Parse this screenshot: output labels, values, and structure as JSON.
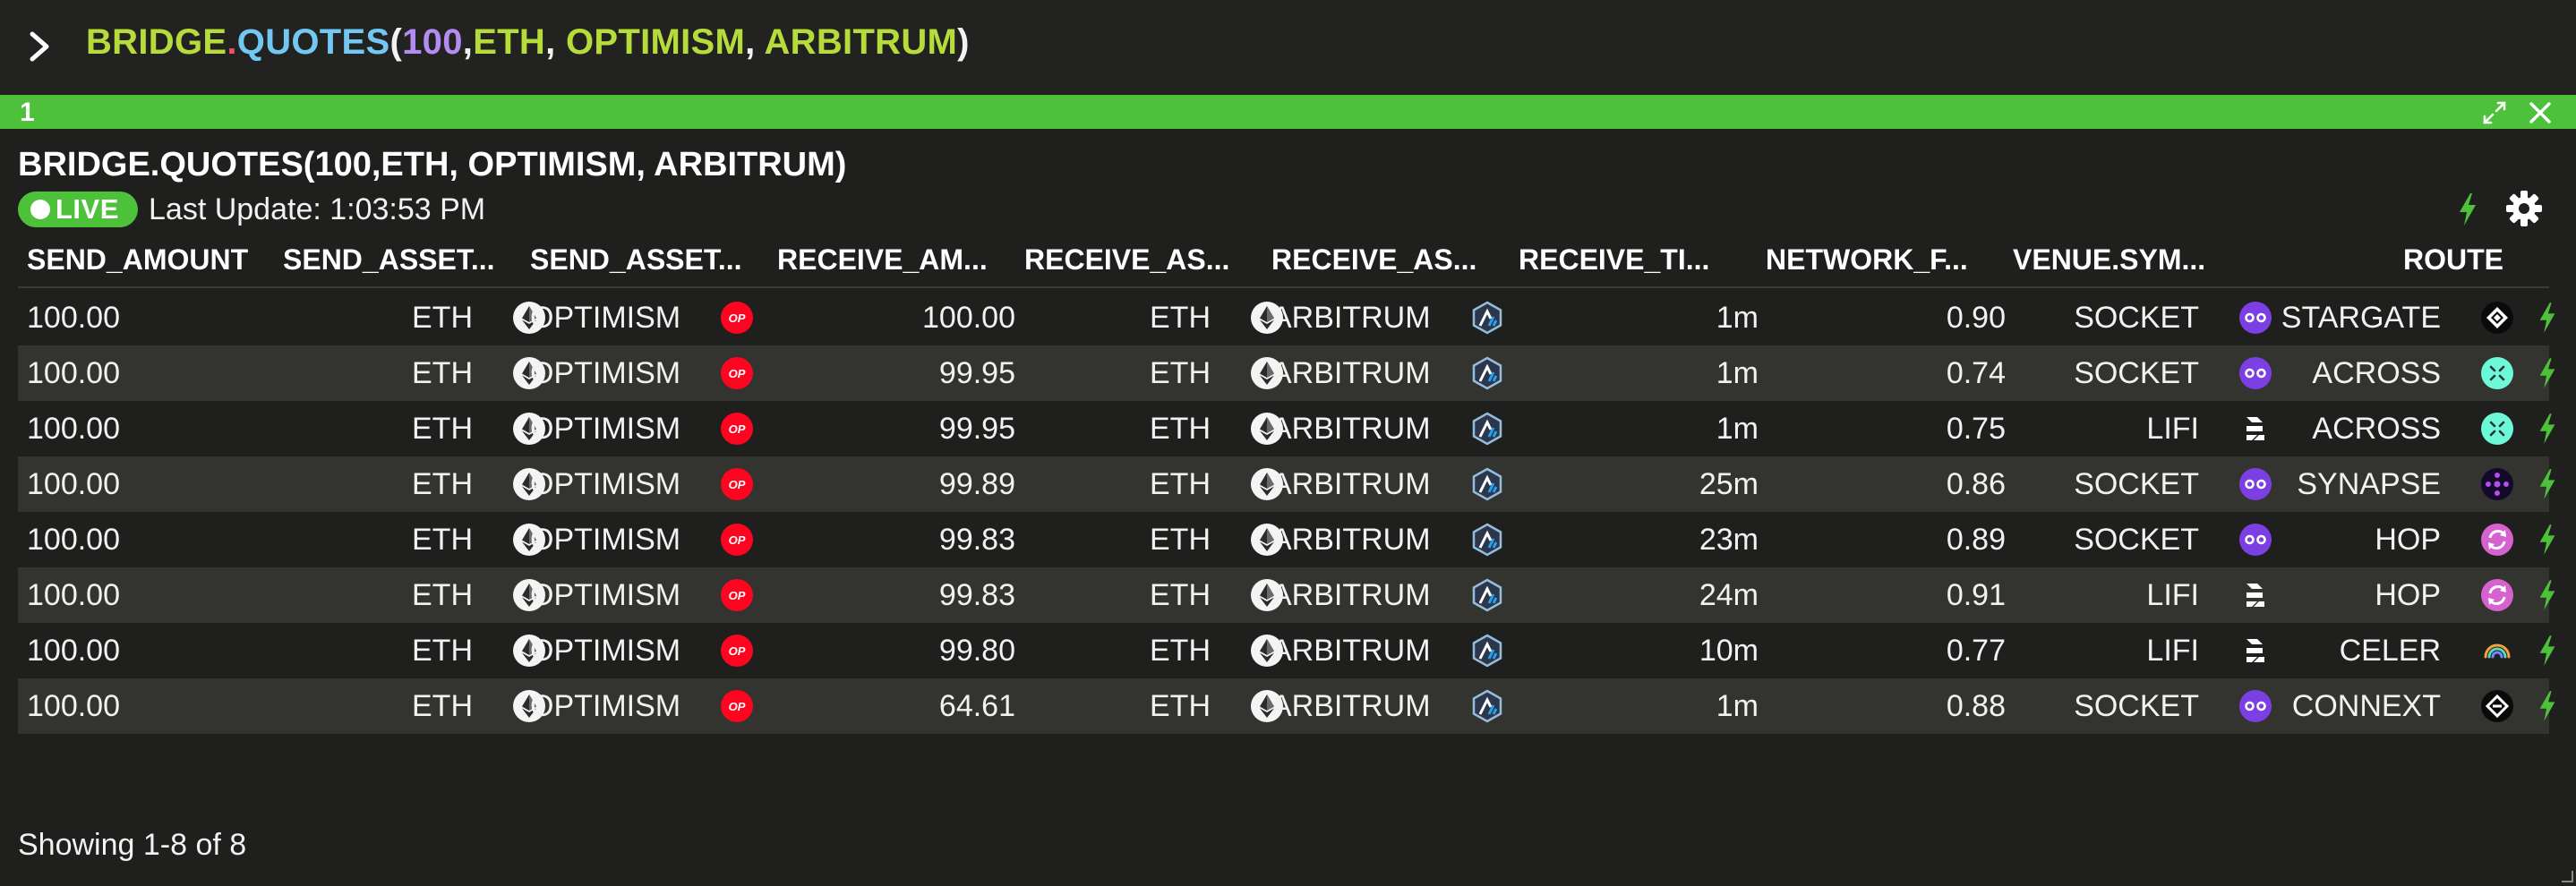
{
  "command": {
    "fn": "BRIDGE",
    "dot": ".",
    "name": "QUOTES",
    "open": "(",
    "num": "100",
    "comma1": ",",
    "arg1": "ETH",
    "comma2": ", ",
    "arg2": "OPTIMISM",
    "comma3": ", ",
    "arg3": "ARBITRUM",
    "close": ")"
  },
  "panel": {
    "index": "1",
    "title": "BRIDGE.QUOTES(100,ETH, OPTIMISM, ARBITRUM)",
    "live_label": "LIVE",
    "last_update": "Last Update: 1:03:53 PM",
    "footer": "Showing 1-8 of 8"
  },
  "colors": {
    "accent_green": "#4ec13a",
    "background": "#1f1f1d",
    "row_alt": "#33332f",
    "socket_purple": "#7b3fe4",
    "optimism_red": "#ff0420"
  },
  "columns": [
    "SEND_AMOUNT",
    "SEND_ASSET...",
    "SEND_ASSET...",
    "RECEIVE_AM...",
    "RECEIVE_AS...",
    "RECEIVE_AS...",
    "RECEIVE_TI...",
    "NETWORK_F...",
    "VENUE.SYM...",
    "ROUTE"
  ],
  "rows": [
    {
      "send_amount": "100.00",
      "send_asset": "ETH",
      "send_chain": "OPTIMISM",
      "receive_amount": "100.00",
      "receive_asset": "ETH",
      "receive_chain": "ARBITRUM",
      "receive_time": "1m",
      "network_fee": "0.90",
      "venue": "SOCKET",
      "venue_icon": "socket-icon",
      "route": "STARGATE",
      "route_icon": "stargate-icon"
    },
    {
      "send_amount": "100.00",
      "send_asset": "ETH",
      "send_chain": "OPTIMISM",
      "receive_amount": "99.95",
      "receive_asset": "ETH",
      "receive_chain": "ARBITRUM",
      "receive_time": "1m",
      "network_fee": "0.74",
      "venue": "SOCKET",
      "venue_icon": "socket-icon",
      "route": "ACROSS",
      "route_icon": "across-icon"
    },
    {
      "send_amount": "100.00",
      "send_asset": "ETH",
      "send_chain": "OPTIMISM",
      "receive_amount": "99.95",
      "receive_asset": "ETH",
      "receive_chain": "ARBITRUM",
      "receive_time": "1m",
      "network_fee": "0.75",
      "venue": "LIFI",
      "venue_icon": "lifi-icon",
      "route": "ACROSS",
      "route_icon": "across-icon"
    },
    {
      "send_amount": "100.00",
      "send_asset": "ETH",
      "send_chain": "OPTIMISM",
      "receive_amount": "99.89",
      "receive_asset": "ETH",
      "receive_chain": "ARBITRUM",
      "receive_time": "25m",
      "network_fee": "0.86",
      "venue": "SOCKET",
      "venue_icon": "socket-icon",
      "route": "SYNAPSE",
      "route_icon": "synapse-icon"
    },
    {
      "send_amount": "100.00",
      "send_asset": "ETH",
      "send_chain": "OPTIMISM",
      "receive_amount": "99.83",
      "receive_asset": "ETH",
      "receive_chain": "ARBITRUM",
      "receive_time": "23m",
      "network_fee": "0.89",
      "venue": "SOCKET",
      "venue_icon": "socket-icon",
      "route": "HOP",
      "route_icon": "hop-icon"
    },
    {
      "send_amount": "100.00",
      "send_asset": "ETH",
      "send_chain": "OPTIMISM",
      "receive_amount": "99.83",
      "receive_asset": "ETH",
      "receive_chain": "ARBITRUM",
      "receive_time": "24m",
      "network_fee": "0.91",
      "venue": "LIFI",
      "venue_icon": "lifi-icon",
      "route": "HOP",
      "route_icon": "hop-icon"
    },
    {
      "send_amount": "100.00",
      "send_asset": "ETH",
      "send_chain": "OPTIMISM",
      "receive_amount": "99.80",
      "receive_asset": "ETH",
      "receive_chain": "ARBITRUM",
      "receive_time": "10m",
      "network_fee": "0.77",
      "venue": "LIFI",
      "venue_icon": "lifi-icon",
      "route": "CELER",
      "route_icon": "celer-icon"
    },
    {
      "send_amount": "100.00",
      "send_asset": "ETH",
      "send_chain": "OPTIMISM",
      "receive_amount": "64.61",
      "receive_asset": "ETH",
      "receive_chain": "ARBITRUM",
      "receive_time": "1m",
      "network_fee": "0.88",
      "venue": "SOCKET",
      "venue_icon": "socket-icon",
      "route": "CONNEXT",
      "route_icon": "connext-icon"
    }
  ]
}
